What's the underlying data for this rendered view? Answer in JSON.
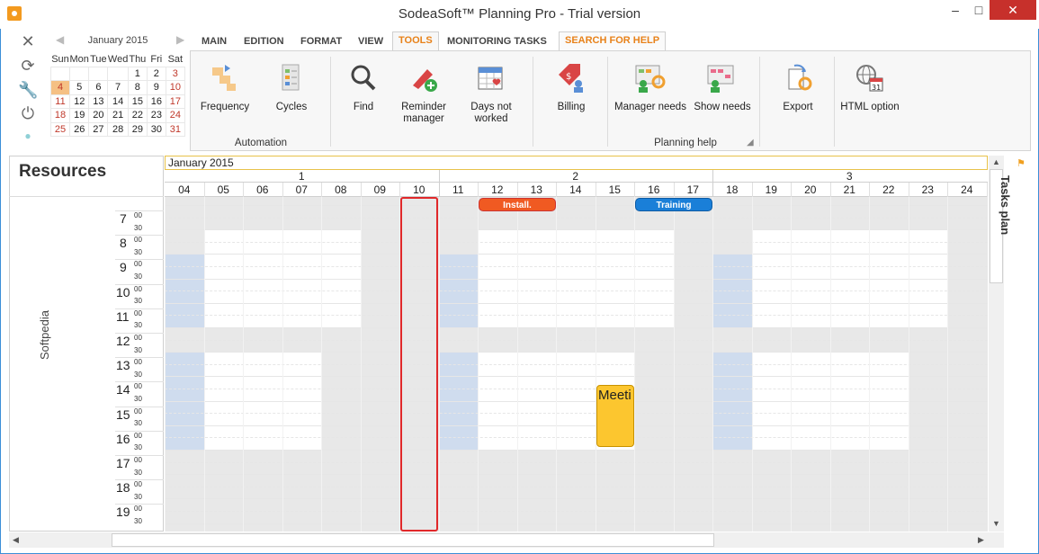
{
  "window": {
    "title": "SodeaSoft™ Planning Pro - Trial version",
    "minimize_label": "–",
    "maximize_label": "□",
    "close_label": "✕"
  },
  "left_toolbar": [
    "close-icon",
    "refresh-icon",
    "wrench-icon",
    "plug-icon",
    "dot-icon"
  ],
  "mini_calendar": {
    "month": "January 2015",
    "prev": "◀",
    "next": "▶",
    "weekdays": [
      "Sun",
      "Mon",
      "Tue",
      "Wed",
      "Thu",
      "Fri",
      "Sat"
    ],
    "weeks": [
      [
        "",
        "",
        "",
        "",
        "1",
        "2",
        "3"
      ],
      [
        "4",
        "5",
        "6",
        "7",
        "8",
        "9",
        "10"
      ],
      [
        "11",
        "12",
        "13",
        "14",
        "15",
        "16",
        "17"
      ],
      [
        "18",
        "19",
        "20",
        "21",
        "22",
        "23",
        "24"
      ],
      [
        "25",
        "26",
        "27",
        "28",
        "29",
        "30",
        "31"
      ]
    ],
    "selected_day": "4"
  },
  "tabs": [
    "MAIN",
    "EDITION",
    "FORMAT",
    "VIEW",
    "TOOLS",
    "MONITORING TASKS",
    "SEARCH FOR HELP"
  ],
  "active_tab": "TOOLS",
  "ribbon": {
    "buttons": {
      "frequency": "Frequency",
      "cycles": "Cycles",
      "find": "Find",
      "reminder_line1": "Reminder",
      "reminder_line2": "manager",
      "days_line1": "Days not",
      "days_line2": "worked",
      "billing": "Billing",
      "manager_needs": "Manager needs",
      "show_needs": "Show needs",
      "export": "Export",
      "html_option": "HTML option"
    },
    "groups": {
      "automation": "Automation",
      "planning_help": "Planning help"
    }
  },
  "scheduler": {
    "resources_title": "Resources",
    "resource_name": "Softpedia",
    "month_label": "January 2015",
    "weeks": [
      "1",
      "2",
      "3"
    ],
    "days": [
      "04",
      "05",
      "06",
      "07",
      "08",
      "09",
      "10",
      "11",
      "12",
      "13",
      "14",
      "15",
      "16",
      "17",
      "18",
      "19",
      "20",
      "21",
      "22",
      "23",
      "24"
    ],
    "hours": [
      "7",
      "8",
      "9",
      "10",
      "11",
      "12",
      "13",
      "14",
      "15",
      "16",
      "17",
      "18",
      "19"
    ],
    "minute_marks": [
      "00",
      "30"
    ],
    "events": {
      "install": "Install.",
      "training": "Training",
      "meeting": "Meeti"
    },
    "side_panel": "Tasks plan"
  },
  "colors": {
    "accent_orange": "#e8821a",
    "install_event": "#f05a22",
    "training_event": "#1a7fd8",
    "meeting_event": "#fcc62f",
    "today_border": "#e0282a",
    "weekend_cell": "#cfdcee"
  }
}
